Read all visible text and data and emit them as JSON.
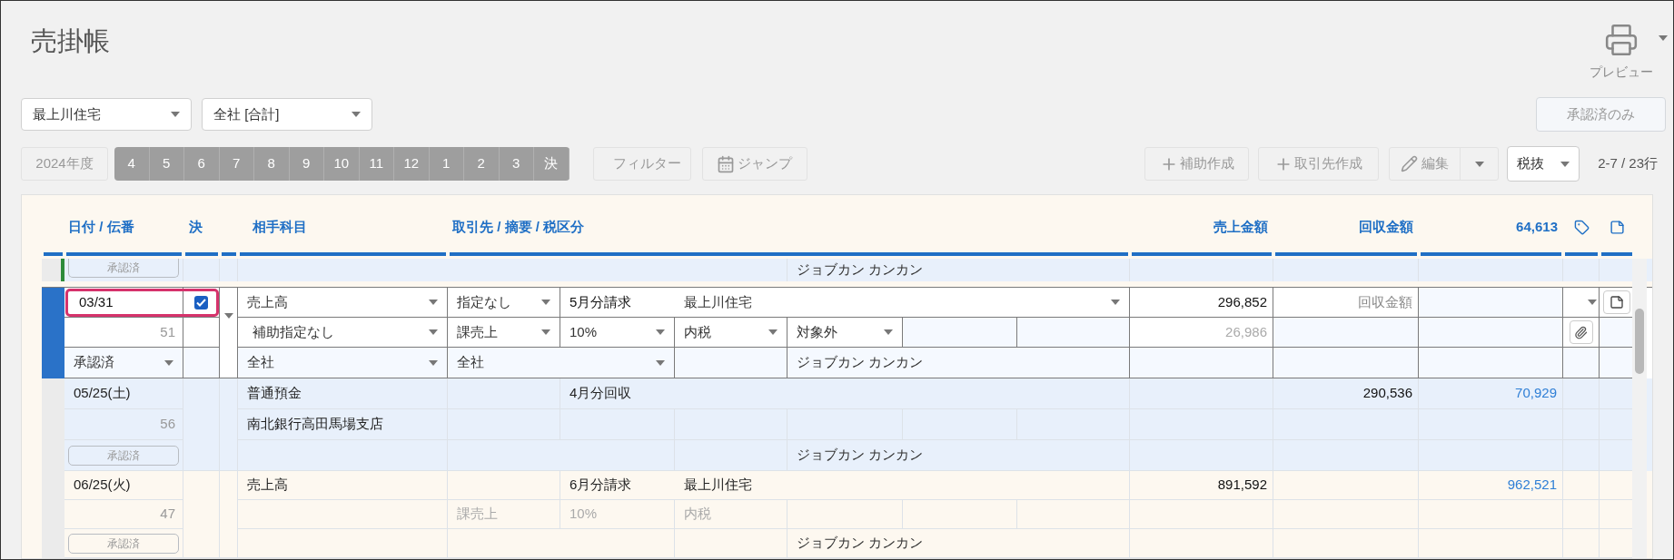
{
  "title": "売掛帳",
  "preview": {
    "label": "プレビュー"
  },
  "filters": [
    {
      "value": "最上川住宅"
    },
    {
      "value": "全社 [合計]"
    }
  ],
  "approved_only": "承認済のみ",
  "fiscal_year": "2024年度",
  "months": [
    "4",
    "5",
    "6",
    "7",
    "8",
    "9",
    "10",
    "11",
    "12",
    "1",
    "2",
    "3",
    "決"
  ],
  "filter_button": "フィルター",
  "jump_button": "ジャンプ",
  "actions": {
    "add_sub": "補助作成",
    "add_partner": "取引先作成",
    "edit": "編集"
  },
  "tax_mode": "税抜",
  "row_count": "2-7 / 23行",
  "columns": {
    "date": "日付 / 伝番",
    "closing": "決",
    "account": "相手科目",
    "partner": "取引先 / 摘要 / 税区分",
    "sales": "売上金額",
    "recovery": "回収金額",
    "balance": "64,613"
  },
  "partial_row": {
    "status": "承認済",
    "member": "ジョブカン カンカン",
    "color": "#2e8b3a"
  },
  "entries": [
    {
      "selected": true,
      "date": "03/31",
      "closing": true,
      "number": "51",
      "status": "承認済",
      "account": "売上高",
      "sub_account": "補助指定なし",
      "department": "全社",
      "partner_type": "指定なし",
      "summary": "5月分請求",
      "partner": "最上川住宅",
      "tax_type": "課売上",
      "tax_rate": "10%",
      "tax_method": "内税",
      "tax_target": "対象外",
      "partner_department": "全社",
      "member": "ジョブカン カンカン",
      "sales": "296,852",
      "sales_tax": "26,986",
      "recovery_placeholder": "回収金額"
    },
    {
      "selected": false,
      "date": "05/25(土)",
      "number": "56",
      "status": "承認済",
      "account": "普通預金",
      "sub_account": "南北銀行高田馬場支店",
      "summary": "4月分回収",
      "member": "ジョブカン カンカン",
      "recovery": "290,536",
      "balance": "70,929"
    },
    {
      "selected": false,
      "date": "06/25(火)",
      "number": "47",
      "status": "承認済",
      "account": "売上高",
      "summary": "6月分請求",
      "partner": "最上川住宅",
      "tax_type": "課売上",
      "tax_rate": "10%",
      "tax_method": "内税",
      "member": "ジョブカン カンカン",
      "sales": "891,592",
      "balance": "962,521"
    }
  ]
}
